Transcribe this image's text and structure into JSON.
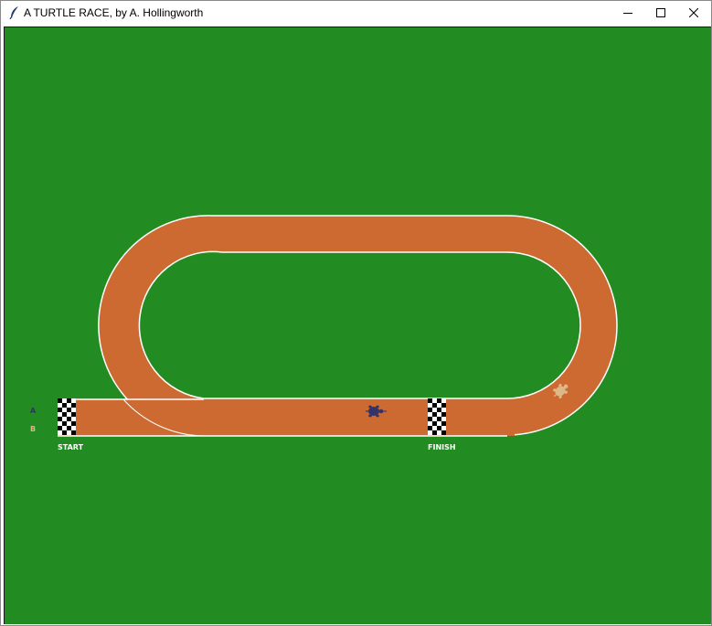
{
  "window": {
    "title": "A TURTLE RACE, by A. Hollingworth",
    "icon": "feather-icon",
    "controls": {
      "minimize_icon": "minimize-icon",
      "maximize_icon": "maximize-icon",
      "close_icon": "close-icon"
    }
  },
  "scene": {
    "background_color": "#228b22",
    "track_color": "#cd6a32",
    "track_edge_color": "#ffffff",
    "start_label": "START",
    "finish_label": "FINISH",
    "lanes": [
      {
        "label": "A",
        "color": "#333366"
      },
      {
        "label": "B",
        "color": "#deb887"
      }
    ],
    "turtles": [
      {
        "name": "A",
        "color": "#333366",
        "icon": "turtle-icon"
      },
      {
        "name": "B",
        "color": "#deb887",
        "icon": "turtle-icon"
      }
    ]
  }
}
